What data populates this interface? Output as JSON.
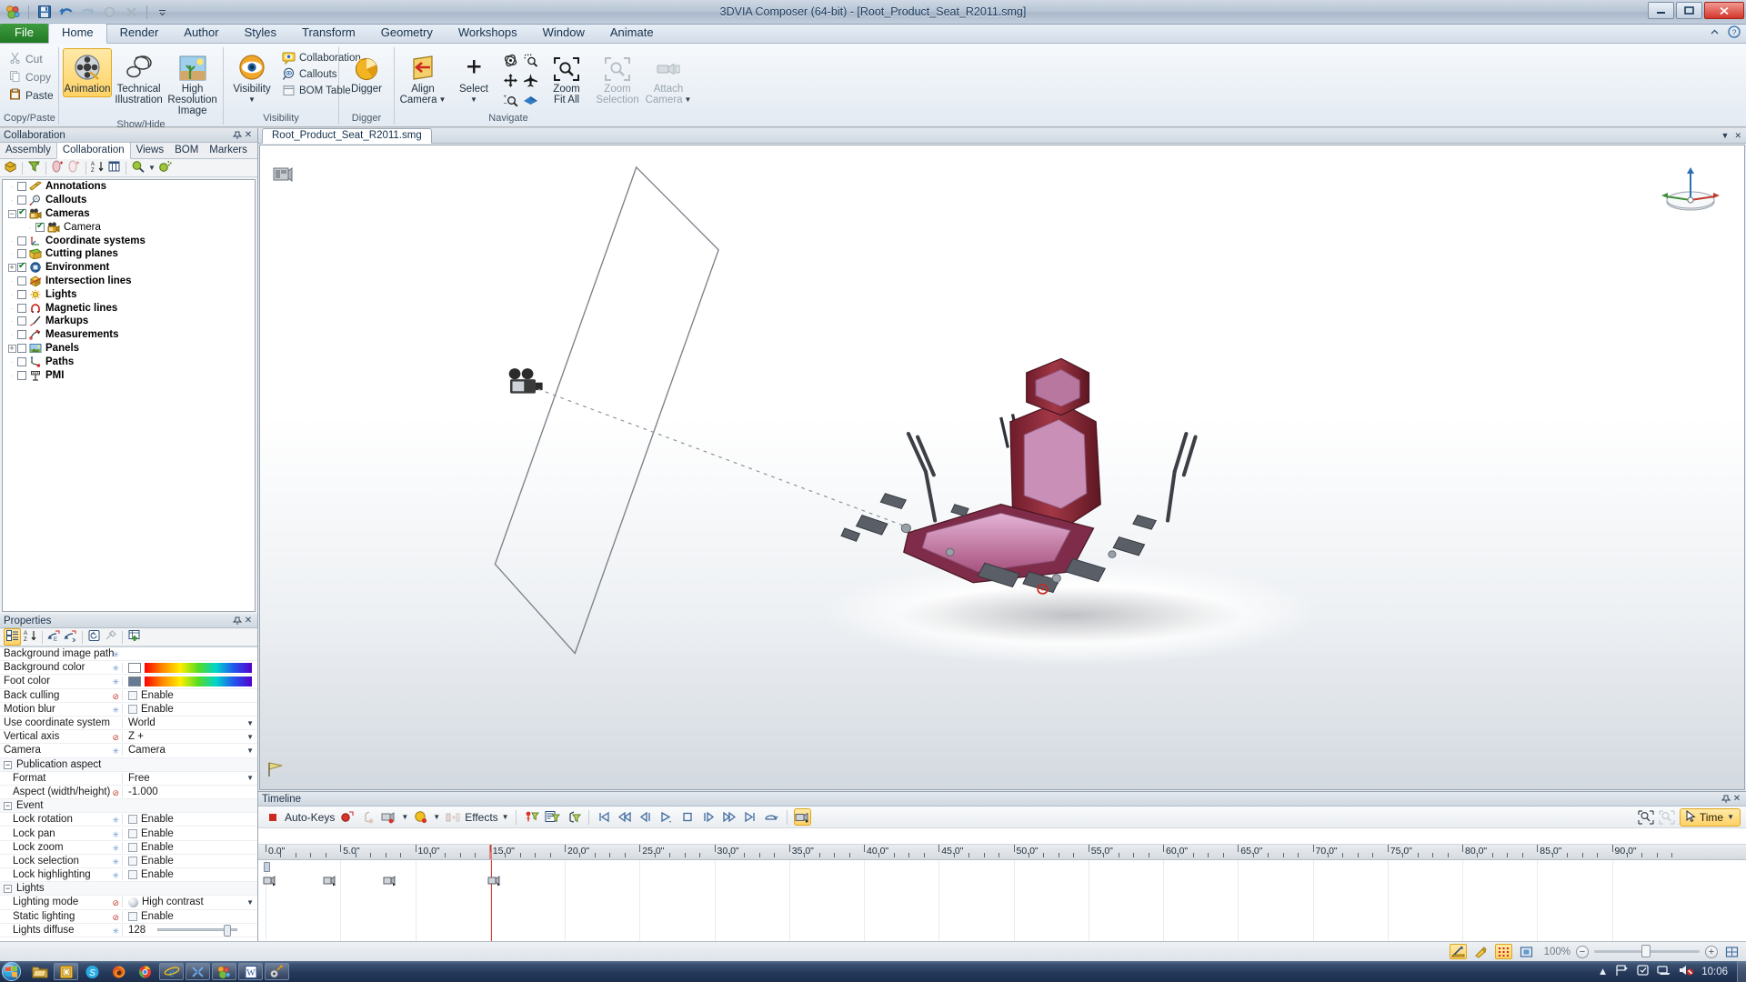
{
  "window": {
    "title": "3DVIA Composer (64-bit) - [Root_Product_Seat_R2011.smg]",
    "minimize": "—",
    "maximize": "▭",
    "close": "✕"
  },
  "quick_access": [
    {
      "name": "app-menu-icon",
      "glyph": "palette"
    },
    {
      "name": "save-icon",
      "glyph": "save"
    },
    {
      "name": "undo-icon",
      "glyph": "undo"
    },
    {
      "name": "redo-icon",
      "glyph": "redo"
    },
    {
      "name": "record-icon",
      "glyph": "record"
    },
    {
      "name": "delete-icon",
      "glyph": "delete"
    },
    {
      "name": "customize-qat-icon",
      "glyph": "chevron-down"
    }
  ],
  "ribbon": {
    "tabs": [
      {
        "label": "File",
        "active": false,
        "file": true
      },
      {
        "label": "Home",
        "active": true
      },
      {
        "label": "Render",
        "active": false
      },
      {
        "label": "Author",
        "active": false
      },
      {
        "label": "Styles",
        "active": false
      },
      {
        "label": "Transform",
        "active": false
      },
      {
        "label": "Geometry",
        "active": false
      },
      {
        "label": "Workshops",
        "active": false
      },
      {
        "label": "Window",
        "active": false
      },
      {
        "label": "Animate",
        "active": false
      }
    ],
    "help_icons": [
      "minimize-ribbon-icon",
      "help-icon"
    ],
    "groups": [
      {
        "title": "Copy/Paste",
        "small_items": [
          {
            "label": "Cut",
            "icon": "cut-icon",
            "disabled": true
          },
          {
            "label": "Copy",
            "icon": "copy-icon",
            "disabled": true
          },
          {
            "label": "Paste",
            "icon": "paste-icon",
            "disabled": false
          }
        ]
      },
      {
        "title": "Show/Hide",
        "big_items": [
          {
            "label": "Animation",
            "icon": "animation-icon",
            "selected": true
          },
          {
            "label": "Technical Illustration",
            "icon": "technical-illustration-icon",
            "selected": false
          },
          {
            "label": "High Resolution Image",
            "icon": "high-resolution-image-icon",
            "selected": false
          }
        ]
      },
      {
        "title": "Visibility",
        "big_items": [
          {
            "label": "Visibility",
            "icon": "visibility-eye-icon",
            "dropdown": true
          }
        ],
        "small_items": [
          {
            "label": "Collaboration",
            "icon": "collaboration-icon"
          },
          {
            "label": "Callouts",
            "icon": "callouts-icon"
          },
          {
            "label": "BOM Table",
            "icon": "bom-table-icon"
          }
        ]
      },
      {
        "title": "Digger",
        "big_items": [
          {
            "label": "Digger",
            "icon": "digger-icon"
          }
        ]
      },
      {
        "title": "Navigate",
        "big_items": [
          {
            "label": "Align Camera",
            "icon": "align-camera-icon",
            "dropdown": true
          },
          {
            "label": "Select",
            "icon": "select-cross-icon",
            "dropdown": true
          },
          {
            "label": "Zoom Fit All",
            "icon": "zoom-fit-all-icon"
          },
          {
            "label": "Zoom Selection",
            "icon": "zoom-selection-icon",
            "disabled": true
          },
          {
            "label": "Attach Camera",
            "icon": "attach-camera-icon",
            "dropdown": true,
            "disabled": true
          }
        ],
        "grid_icons": [
          "rotate-icon",
          "zoom-area-icon",
          "pan-icon",
          "fly-icon",
          "zoom-in-out-icon",
          "walk-icon"
        ]
      }
    ]
  },
  "collaboration_panel": {
    "caption": "Collaboration",
    "caption_buttons": [
      "pin-icon",
      "close-icon"
    ],
    "tabs": [
      {
        "label": "Assembly",
        "active": false
      },
      {
        "label": "Collaboration",
        "active": true
      },
      {
        "label": "Views",
        "active": false
      },
      {
        "label": "BOM",
        "active": false
      },
      {
        "label": "Markers",
        "active": false
      }
    ],
    "toolbar_icons": [
      "show-all-icon",
      "filter-tree-icon",
      "add-neutral-icon",
      "add-transparent-icon",
      "sort-az-icon",
      "columns-icon",
      "search-icon",
      "search-dropdown-icon",
      "advanced-search-icon"
    ],
    "tree": [
      {
        "label": "Annotations",
        "icon": "annotations-icon",
        "checked": false,
        "expander": "",
        "level": 0
      },
      {
        "label": "Callouts",
        "icon": "callouts-icon",
        "checked": false,
        "expander": "",
        "level": 0
      },
      {
        "label": "Cameras",
        "icon": "camera-icon",
        "checked": true,
        "expander": "minus",
        "level": 0
      },
      {
        "label": "Camera",
        "icon": "camera-icon",
        "checked": true,
        "expander": "",
        "level": 1
      },
      {
        "label": "Coordinate systems",
        "icon": "coordinate-systems-icon",
        "checked": false,
        "expander": "",
        "level": 0
      },
      {
        "label": "Cutting planes",
        "icon": "cutting-planes-icon",
        "checked": false,
        "expander": "",
        "level": 0
      },
      {
        "label": "Environment",
        "icon": "environment-icon",
        "checked": true,
        "expander": "plus",
        "level": 0
      },
      {
        "label": "Intersection lines",
        "icon": "intersection-lines-icon",
        "checked": false,
        "expander": "",
        "level": 0
      },
      {
        "label": "Lights",
        "icon": "lights-icon",
        "checked": false,
        "expander": "",
        "level": 0
      },
      {
        "label": "Magnetic lines",
        "icon": "magnetic-lines-icon",
        "checked": false,
        "expander": "",
        "level": 0
      },
      {
        "label": "Markups",
        "icon": "markups-icon",
        "checked": false,
        "expander": "",
        "level": 0
      },
      {
        "label": "Measurements",
        "icon": "measurements-icon",
        "checked": false,
        "expander": "",
        "level": 0
      },
      {
        "label": "Panels",
        "icon": "panels-icon",
        "checked": false,
        "expander": "plus",
        "level": 0
      },
      {
        "label": "Paths",
        "icon": "paths-icon",
        "checked": false,
        "expander": "",
        "level": 0
      },
      {
        "label": "PMI",
        "icon": "pmi-icon",
        "checked": false,
        "expander": "",
        "level": 0
      }
    ]
  },
  "properties_panel": {
    "caption": "Properties",
    "caption_buttons": [
      "pin-icon",
      "close-icon"
    ],
    "toolbar_icons": [
      "categorized-icon",
      "sort-az-icon",
      "previous-event-icon",
      "next-event-icon",
      "reset-icon",
      "eyedropper-icon",
      "add-property-icon"
    ],
    "rows": [
      {
        "name": "Background image path",
        "value": "",
        "type": "text",
        "mark": "blue"
      },
      {
        "name": "Background color",
        "value": "",
        "type": "color",
        "swatch": "#ffffff",
        "mark": "blue"
      },
      {
        "name": "Foot color",
        "value": "",
        "type": "color",
        "swatch": "#667a94",
        "mark": "blue"
      },
      {
        "name": "Back culling",
        "value": "Enable",
        "type": "checkbox",
        "checked": false,
        "mark": "red"
      },
      {
        "name": "Motion blur",
        "value": "Enable",
        "type": "checkbox",
        "checked": false,
        "mark": "blue"
      },
      {
        "name": "Use coordinate system",
        "value": "World",
        "type": "combo",
        "mark": ""
      },
      {
        "name": "Vertical axis",
        "value": "Z +",
        "type": "combo",
        "mark": "red"
      },
      {
        "name": "Camera",
        "value": "Camera",
        "type": "combo",
        "mark": "blue"
      },
      {
        "name": "Publication aspect",
        "value": "",
        "type": "group",
        "expander": "minus"
      },
      {
        "name": "Format",
        "value": "Free",
        "type": "combo",
        "indent": true,
        "mark": ""
      },
      {
        "name": "Aspect (width/height)",
        "value": "-1.000",
        "type": "text",
        "indent": true,
        "mark": "red"
      },
      {
        "name": "Event",
        "value": "",
        "type": "group",
        "expander": "minus"
      },
      {
        "name": "Lock rotation",
        "value": "Enable",
        "type": "checkbox",
        "checked": false,
        "indent": true,
        "mark": "blue"
      },
      {
        "name": "Lock pan",
        "value": "Enable",
        "type": "checkbox",
        "checked": false,
        "indent": true,
        "mark": "blue"
      },
      {
        "name": "Lock zoom",
        "value": "Enable",
        "type": "checkbox",
        "checked": false,
        "indent": true,
        "mark": "blue"
      },
      {
        "name": "Lock selection",
        "value": "Enable",
        "type": "checkbox",
        "checked": false,
        "indent": true,
        "mark": "blue"
      },
      {
        "name": "Lock highlighting",
        "value": "Enable",
        "type": "checkbox",
        "checked": false,
        "indent": true,
        "mark": "blue"
      },
      {
        "name": "Lights",
        "value": "",
        "type": "group",
        "expander": "minus"
      },
      {
        "name": "Lighting mode",
        "value": "High contrast",
        "type": "ball-combo",
        "indent": true,
        "mark": "red"
      },
      {
        "name": "Static lighting",
        "value": "Enable",
        "type": "checkbox",
        "checked": false,
        "indent": true,
        "mark": "red"
      },
      {
        "name": "Lights diffuse",
        "value": "128",
        "type": "slider",
        "indent": true,
        "mark": "blue"
      }
    ]
  },
  "document": {
    "tab_label": "Root_Product_Seat_R2011.smg",
    "tab_buttons": [
      "restore-icon",
      "close-icon"
    ]
  },
  "viewport": {
    "navigation_cube": "navigation-axis-triad",
    "camera_marker": "camera-gizmo",
    "pivot_marker": "pivot-point"
  },
  "timeline": {
    "caption": "Timeline",
    "caption_buttons": [
      "pin-icon",
      "close-icon"
    ],
    "auto_keys_label": "Auto-Keys",
    "effects_label": "Effects",
    "toolbar_icons": [
      "auto-keys-stop-icon",
      "create-key-icon",
      "create-position-key-icon",
      "create-camera-key-icon",
      "create-color-key-icon",
      "create-opacity-key-icon"
    ],
    "transport_icons": [
      "go-to-start-icon",
      "fast-rewind-icon",
      "step-back-icon",
      "play-icon",
      "stop-icon",
      "step-forward-icon",
      "fast-forward-icon",
      "go-to-end-icon",
      "loop-icon"
    ],
    "selected_tool_icon": "camera-key-tool-icon",
    "right_icons": [
      "filter-keys-icon",
      "filter-keys-disabled-icon"
    ],
    "mode_button": {
      "label": "Time",
      "icon": "cursor-icon",
      "dropdown": true
    },
    "ruler_labels": [
      "0.0\"",
      "5.0\"",
      "10.0\"",
      "15.0\"",
      "20.0\"",
      "25.0\"",
      "30.0\"",
      "35.0\"",
      "40.0\"",
      "45.0\"",
      "50.0\"",
      "55.0\"",
      "60.0\"",
      "65.0\"",
      "70.0\"",
      "75.0\"",
      "80.0\"",
      "85.0\"",
      "90.0\""
    ],
    "ruler_step_seconds": 5,
    "playhead_time": "15.0\"",
    "keys": [
      {
        "time": "0.0\"",
        "icon": "camera-key-icon"
      },
      {
        "time": "4.0\"",
        "icon": "camera-key-icon"
      },
      {
        "time": "8.0\"",
        "icon": "camera-key-icon"
      },
      {
        "time": "15.0\"",
        "icon": "camera-key-icon"
      }
    ]
  },
  "statusbar": {
    "zoom_label": "100%",
    "zoom_minus": "−",
    "zoom_plus": "+",
    "buttons": [
      "measure-icon",
      "paint-icon",
      "grid-snap-icon",
      "fit-view-icon",
      "fit-page-icon"
    ]
  },
  "taskbar": {
    "start": "start-orb",
    "items": [
      {
        "name": "explorer-icon",
        "boxed": false
      },
      {
        "name": "office-note-icon",
        "boxed": true
      },
      {
        "name": "skype-icon",
        "boxed": false
      },
      {
        "name": "firefox-icon",
        "boxed": false
      },
      {
        "name": "chrome-icon",
        "boxed": false
      },
      {
        "name": "internet-explorer-icon",
        "boxed": true
      },
      {
        "name": "catia-icon",
        "boxed": true
      },
      {
        "name": "composer-icon",
        "boxed": true
      },
      {
        "name": "word-icon",
        "boxed": true
      },
      {
        "name": "composer-player-icon",
        "boxed": true
      }
    ],
    "tray_icons": [
      "show-hidden-icon",
      "flag-icon",
      "action-center-icon",
      "network-icon",
      "volume-muted-icon"
    ],
    "clock": "10:06"
  },
  "colors": {
    "accent_yellow": "#ffd166",
    "file_tab_green": "#2e8b32",
    "playhead_red": "#e23b2e",
    "seat_red": "#9c2f3e",
    "seat_pink": "#d99ec4"
  }
}
